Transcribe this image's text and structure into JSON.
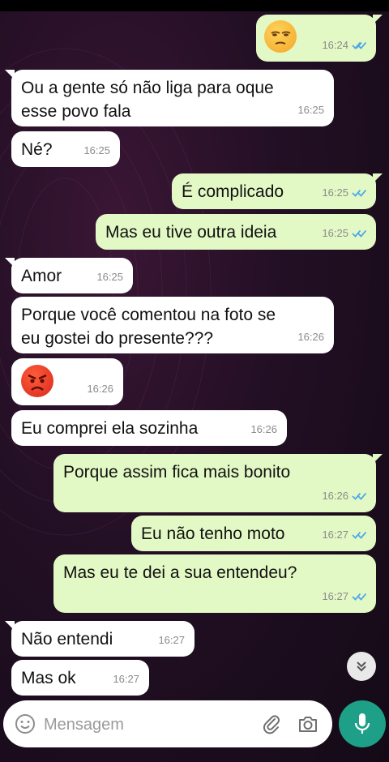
{
  "colors": {
    "incoming_bubble": "#ffffff",
    "outgoing_bubble": "#e3f9c5",
    "read_ticks": "#4fa8e8",
    "mic_button": "#1ea088"
  },
  "messages": [
    {
      "dir": "out",
      "emoji": "unamused-face",
      "time": "16:24",
      "read": true
    },
    {
      "dir": "in",
      "text": "Ou a gente só não liga para oque\nesse povo fala",
      "time": "16:25"
    },
    {
      "dir": "in",
      "text": "Né?",
      "time": "16:25"
    },
    {
      "dir": "out",
      "text": "É complicado",
      "time": "16:25",
      "read": true
    },
    {
      "dir": "out",
      "text": "Mas eu tive outra ideia",
      "time": "16:25",
      "read": true
    },
    {
      "dir": "in",
      "text": "Amor",
      "time": "16:25"
    },
    {
      "dir": "in",
      "text": "Porque você comentou na foto se\neu gostei do presente???",
      "time": "16:26"
    },
    {
      "dir": "in",
      "emoji": "angry-face",
      "time": "16:26"
    },
    {
      "dir": "in",
      "text": "Eu comprei ela sozinha",
      "time": "16:26"
    },
    {
      "dir": "out",
      "text": "Porque assim fica mais bonito",
      "time": "16:26",
      "read": true
    },
    {
      "dir": "out",
      "text": "Eu não tenho moto",
      "time": "16:27",
      "read": true
    },
    {
      "dir": "out",
      "text": "Mas eu te dei a sua entendeu?",
      "time": "16:27",
      "read": true
    },
    {
      "dir": "in",
      "text": "Não entendi",
      "time": "16:27"
    },
    {
      "dir": "in",
      "text": "Mas ok",
      "time": "16:27"
    }
  ],
  "composer": {
    "placeholder": "Mensagem"
  },
  "icons": {
    "emoji": "emoji-icon",
    "attach": "paperclip-icon",
    "camera": "camera-icon",
    "mic": "mic-icon",
    "scroll": "chevron-double-down-icon"
  }
}
